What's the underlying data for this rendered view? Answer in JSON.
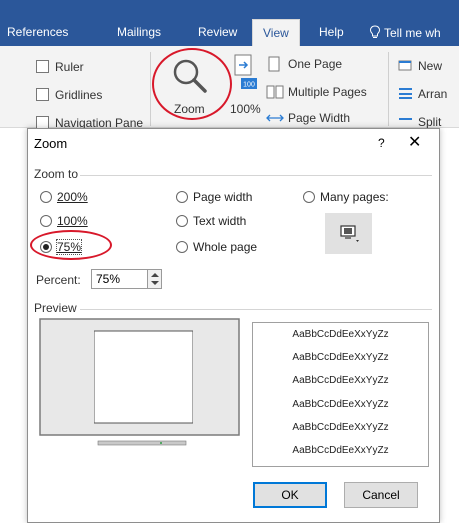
{
  "ribbon_tabs": {
    "references": "References",
    "mailings": "Mailings",
    "review": "Review",
    "view": "View",
    "help": "Help",
    "tell_me": "Tell me wh"
  },
  "ribbon": {
    "ruler": "Ruler",
    "gridlines": "Gridlines",
    "navigation_pane": "Navigation Pane",
    "zoom": "Zoom",
    "hundred_percent": "100%",
    "hundred_icon_text": "100",
    "one_page": "One Page",
    "multiple_pages": "Multiple Pages",
    "page_width": "Page Width",
    "new_window": "New",
    "arrange": "Arran",
    "split": "Split"
  },
  "dialog": {
    "title": "Zoom",
    "help": "?",
    "close": "✕",
    "zoom_to_label": "Zoom to",
    "opt_200": "200%",
    "opt_100": "100%",
    "opt_75": "75%",
    "opt_page_width": "Page width",
    "opt_text_width": "Text width",
    "opt_whole_page": "Whole page",
    "opt_many_pages": "Many pages:",
    "percent_label": "Percent:",
    "percent_value": "75%",
    "preview_label": "Preview",
    "sample_text": [
      "AaBbCcDdEeXxYyZz",
      "AaBbCcDdEeXxYyZz",
      "AaBbCcDdEeXxYyZz",
      "AaBbCcDdEeXxYyZz",
      "AaBbCcDdEeXxYyZz",
      "AaBbCcDdEeXxYyZz"
    ],
    "ok": "OK",
    "cancel": "Cancel",
    "selected_option": "75%"
  },
  "colors": {
    "ribbon_blue": "#2b579a",
    "highlight_circle": "#d8182a",
    "ok_border": "#0078d7"
  }
}
